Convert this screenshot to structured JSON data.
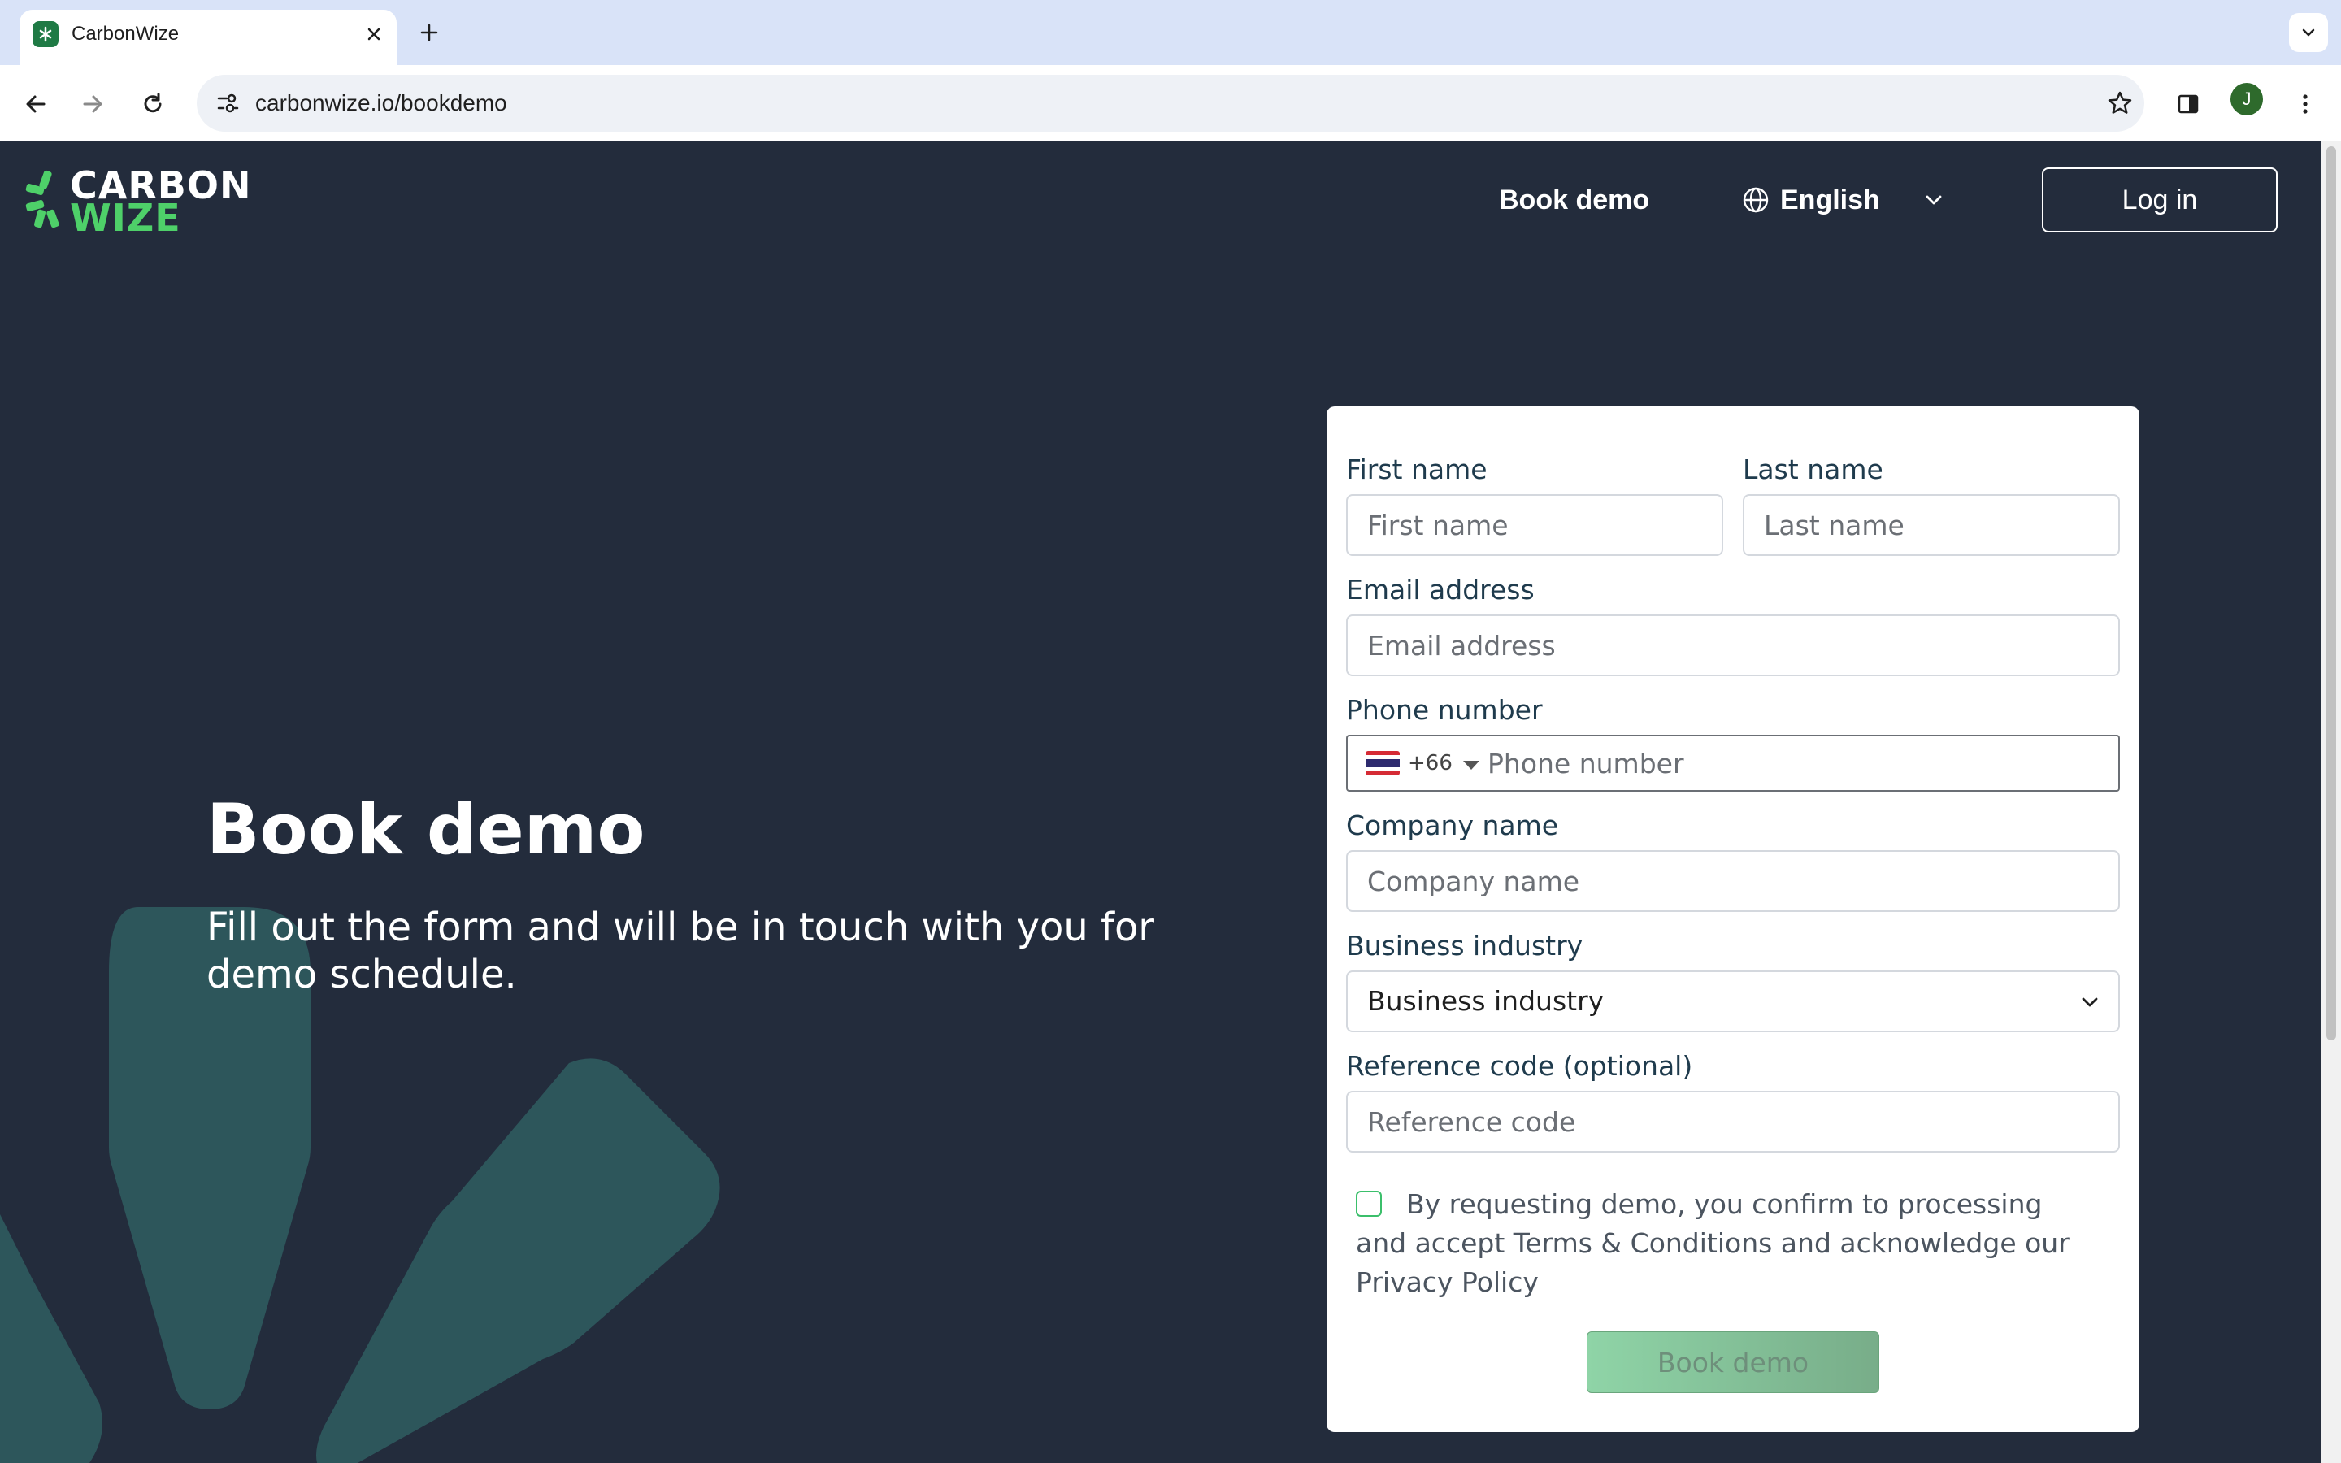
{
  "browser": {
    "tab_title": "CarbonWize",
    "url": "carbonwize.io/bookdemo",
    "profile_initial": "J",
    "icons": [
      "favicon",
      "close-icon",
      "plus-icon",
      "chevron-down-icon",
      "back-icon",
      "forward-icon",
      "reload-icon",
      "site-info-icon",
      "star-icon",
      "sidepanel-icon",
      "kebab-menu-icon"
    ]
  },
  "header": {
    "logo_line1": "CARBON",
    "logo_line2": "WIZE",
    "nav_book_demo": "Book demo",
    "language": "English",
    "login_label": "Log in"
  },
  "hero": {
    "title": "Book demo",
    "subtitle": "Fill out the form and will be in touch with you for demo schedule."
  },
  "form": {
    "first_name_label": "First name",
    "first_name_placeholder": "First name",
    "last_name_label": "Last name",
    "last_name_placeholder": "Last name",
    "email_label": "Email address",
    "email_placeholder": "Email address",
    "phone_label": "Phone number",
    "phone_dial_code": "+66",
    "phone_placeholder": "Phone number",
    "company_label": "Company name",
    "company_placeholder": "Company name",
    "industry_label": "Business industry",
    "industry_selected": "Business industry",
    "reference_label": "Reference code (optional)",
    "reference_placeholder": "Reference code",
    "consent_text": "By requesting demo, you confirm to processing and accept Terms & Conditions and acknowledge our Privacy Policy",
    "submit_label": "Book demo"
  },
  "colors": {
    "page_bg": "#232c3c",
    "brand_green": "#4ed069",
    "decor_teal": "#2f5a5e",
    "submit_green": "#8fd4a7"
  }
}
